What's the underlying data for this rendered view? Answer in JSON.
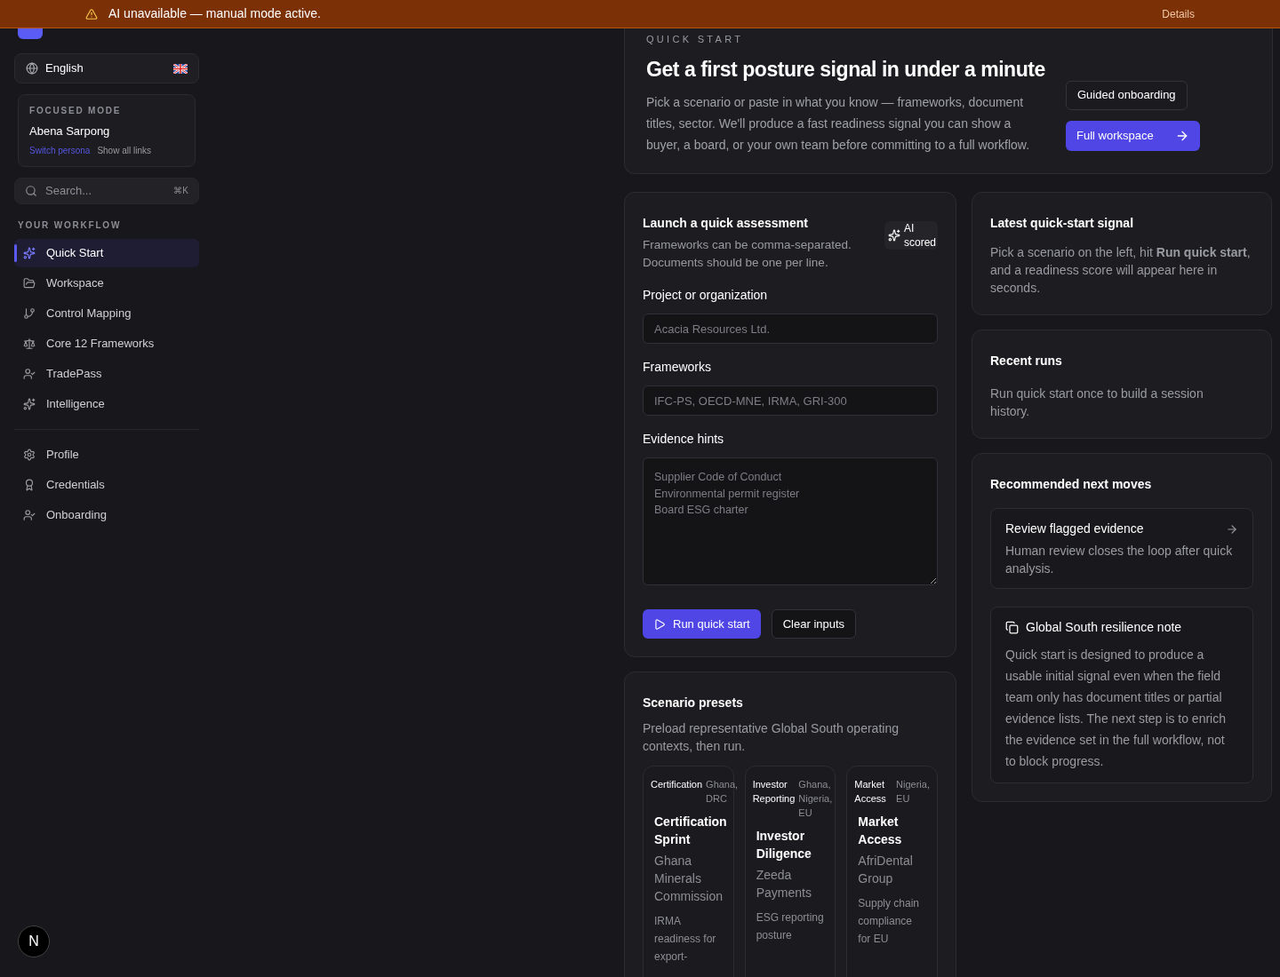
{
  "banner": {
    "message": "AI unavailable — manual mode active.",
    "action": "Details"
  },
  "sidebar": {
    "language": {
      "label": "English"
    },
    "focused_mode": {
      "heading": "FOCUSED MODE",
      "name": "Abena Sarpong",
      "switch_link": "Switch persona",
      "show_link": "Show all links"
    },
    "search": {
      "placeholder": "Search...",
      "shortcut": "⌘K"
    },
    "section_label": "YOUR WORKFLOW",
    "items": [
      {
        "label": "Quick Start",
        "selected": true
      },
      {
        "label": "Workspace",
        "selected": false
      },
      {
        "label": "Control Mapping",
        "selected": false
      },
      {
        "label": "Core 12 Frameworks",
        "selected": false
      },
      {
        "label": "TradePass",
        "selected": false
      },
      {
        "label": "Intelligence",
        "selected": false
      }
    ],
    "secondary_items": [
      {
        "label": "Profile",
        "selected": false
      },
      {
        "label": "Credentials",
        "selected": false
      },
      {
        "label": "Onboarding",
        "selected": false
      }
    ],
    "dev_badge": "N"
  },
  "hero": {
    "eyebrow": "QUICK START",
    "title": "Get a first posture signal in under a minute",
    "body": "Pick a scenario or paste in what you know — frameworks, document titles, sector. We'll produce a fast readiness signal you can show a buyer, a board, or your own team before committing to a full workflow.",
    "secondary_button": "Guided onboarding",
    "primary_button": "Full workspace"
  },
  "assessment": {
    "title": "Launch a quick assessment",
    "subtitle": "Frameworks can be comma-separated. Documents should be one per line.",
    "badge": "AI scored",
    "fields": [
      {
        "label": "Project or organization",
        "kind": "input",
        "placeholder": "Acacia Resources Ltd."
      },
      {
        "label": "Frameworks",
        "kind": "input",
        "placeholder": "IFC-PS, OECD-MNE, IRMA, GRI-300"
      },
      {
        "label": "Evidence hints",
        "kind": "textarea",
        "placeholder": "Supplier Code of Conduct\nEnvironmental permit register\nBoard ESG charter"
      }
    ],
    "run_button": "Run quick start",
    "clear_button": "Clear inputs"
  },
  "presets": {
    "title": "Scenario presets",
    "subtitle": "Preload representative Global South operating contexts, then run.",
    "items": [
      {
        "tag": "Certification",
        "region": "Ghana, DRC",
        "title": "Certification Sprint",
        "org": "Ghana Minerals Commission",
        "description": "IRMA readiness for export-"
      },
      {
        "tag": "Investor Reporting",
        "region": "Ghana, Nigeria, EU",
        "title": "Investor Diligence",
        "org": "Zeeda Payments",
        "description": "ESG reporting posture"
      },
      {
        "tag": "Market Access",
        "region": "Nigeria, EU",
        "title": "Market Access",
        "org": "AfriDental Group",
        "description": "Supply chain compliance for EU"
      }
    ]
  },
  "signal": {
    "title": "Latest quick-start signal",
    "body": "Pick a scenario on the left, hit **Run quick start**, and a readiness score will appear here in seconds."
  },
  "recent": {
    "title": "Recent runs",
    "body": "Run quick start once to build a session history."
  },
  "next_moves": {
    "title": "Recommended next moves",
    "items": [
      {
        "kind": "link",
        "title": "Review flagged evidence",
        "body": "Human review closes the loop after quick analysis."
      },
      {
        "kind": "note",
        "title": "Global South resilience note",
        "body": "Quick start is designed to produce a usable initial signal even when the field team only has document titles or partial evidence lists. The next step is to enrich the evidence set in the full workflow, not to block progress."
      }
    ]
  }
}
